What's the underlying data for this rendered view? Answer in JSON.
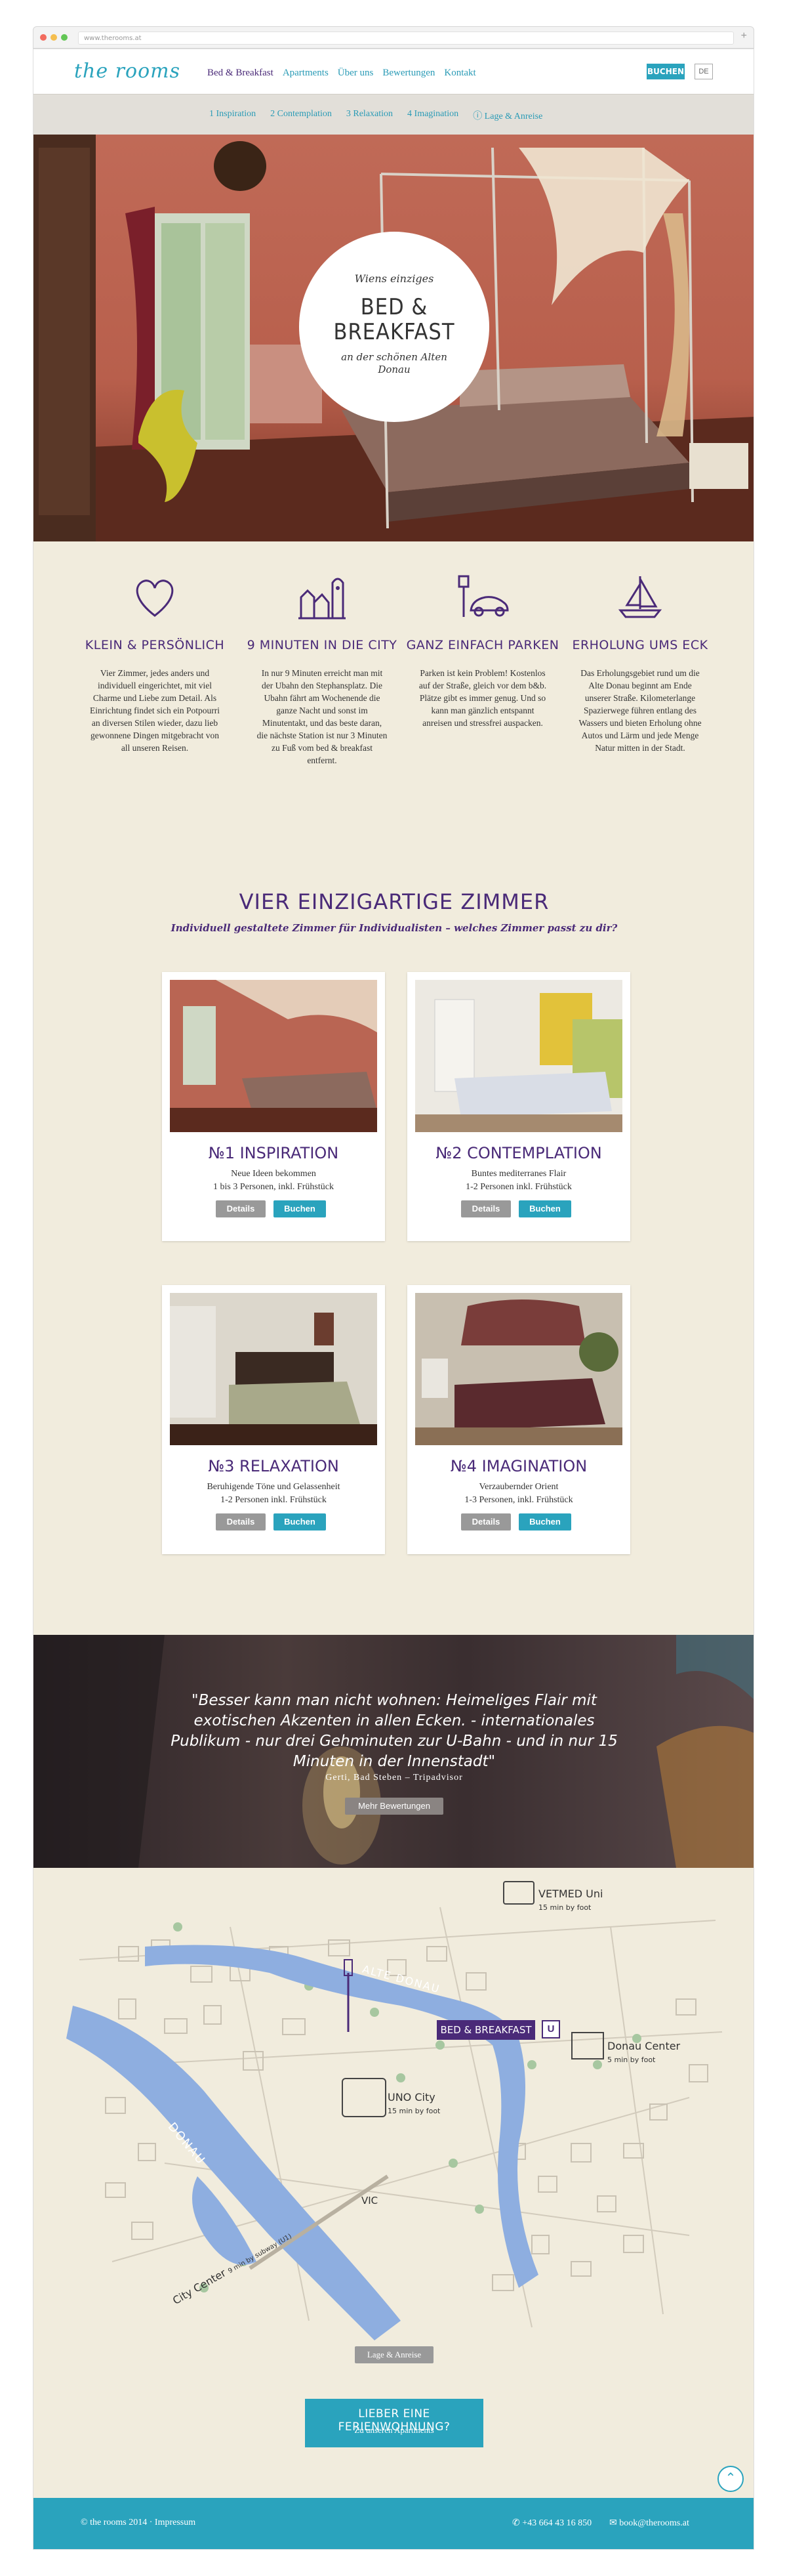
{
  "browser": {
    "url": "www.therooms.at"
  },
  "header": {
    "logo": "the rooms",
    "nav": [
      "Bed & Breakfast",
      "Apartments",
      "Über uns",
      "Bewertungen",
      "Kontakt"
    ],
    "book_label": "BUCHEN",
    "lang_label": "DE"
  },
  "subnav": [
    "1 Inspiration",
    "2 Contemplation",
    "3 Relaxation",
    "4 Imagination",
    "ⓘ Lage & Anreise"
  ],
  "hero": {
    "line1": "Wiens einziges",
    "line2": "BED &",
    "line2b": "BREAKFAST",
    "line3": "an der schönen Alten Donau"
  },
  "features": [
    {
      "icon": "heart-icon",
      "title": "KLEIN & PERSÖNLICH",
      "text": "Vier Zimmer, jedes anders und individuell eingerichtet, mit viel Charme und Liebe zum Detail. Als Einrichtung findet sich ein Potpourri an diversen Stilen wieder, dazu lieb gewonnene Dingen mitgebracht von all unseren Reisen."
    },
    {
      "icon": "city-icon",
      "title": "9 MINUTEN IN DIE CITY",
      "text": "In nur 9 Minuten erreicht man mit der Ubahn den Stephansplatz. Die Ubahn fährt am Wochenende die ganze Nacht und sonst im Minutentakt, und das beste daran, die nächste Station ist nur 3 Minuten zu Fuß vom bed & breakfast entfernt."
    },
    {
      "icon": "car-parking-icon",
      "title": "GANZ EINFACH PARKEN",
      "text": "Parken ist kein Problem! Kostenlos auf der Straße, gleich vor dem b&b. Plätze gibt es immer genug. Und so kann man gänzlich entspannt anreisen und stressfrei auspacken."
    },
    {
      "icon": "sailboat-icon",
      "title": "ERHOLUNG UMS ECK",
      "text": "Das Erholungsgebiet rund um die Alte Donau beginnt am Ende unserer Straße. Kilometerlange Spazierwege führen entlang des Wassers und bieten Erholung ohne Autos und Lärm und jede Menge Natur mitten in der Stadt."
    }
  ],
  "rooms_section": {
    "title": "VIER EINZIGARTIGE ZIMMER",
    "subtitle": "Individuell gestaltete Zimmer für Individualisten – welches Zimmer passt zu dir?",
    "details_label": "Details",
    "book_label": "Buchen",
    "rooms": [
      {
        "name": "№1 INSPIRATION",
        "desc1": "Neue Ideen bekommen",
        "desc2": "1 bis 3 Personen, inkl. Frühstück",
        "accent": "#c06a57"
      },
      {
        "name": "№2 CONTEMPLATION",
        "desc1": "Buntes mediterranes Flair",
        "desc2": "1-2 Personen inkl. Frühstück",
        "accent": "#e2c23a"
      },
      {
        "name": "№3 RELAXATION",
        "desc1": "Beruhigende Töne und Gelassenheit",
        "desc2": "1-2 Personen inkl. Frühstück",
        "accent": "#6b5a48"
      },
      {
        "name": "№4 IMAGINATION",
        "desc1": "Verzaubernder Orient",
        "desc2": "1-3 Personen, inkl. Frühstück",
        "accent": "#7a3d3a"
      }
    ]
  },
  "quote": {
    "text": "\"Besser kann man nicht wohnen: Heimeliges Flair mit exotischen Akzenten in allen Ecken. - internationales Publikum - nur drei Gehminuten zur U-Bahn - und in nur 15 Minuten in der Innenstadt\"",
    "author": "Gerti, Bad Steben – Tripadvisor",
    "button": "Mehr Bewertungen"
  },
  "map": {
    "river_label": "DONAU",
    "old_river_label": "ALTE DONAU",
    "bnb_label": "BED & BREAKFAST",
    "ubahn_label": "U",
    "places": [
      {
        "name": "VETMED Uni",
        "note": "15 min by foot"
      },
      {
        "name": "Donau Center",
        "note": "5 min by foot"
      },
      {
        "name": "UNO City",
        "note": "15 min by foot"
      },
      {
        "name": "VIC",
        "note": ""
      },
      {
        "name": "City Center",
        "note": "9 min by subway (U1)"
      }
    ],
    "button": "Lage & Anreise"
  },
  "apartments_cta": {
    "line1": "LIEBER EINE FERIENWOHNUNG?",
    "line2": "Zu unseren Apartments"
  },
  "footer": {
    "left": "© the rooms 2014 · Impressum",
    "phone": "+43 664 43 16 850",
    "mail": "book@therooms.at"
  },
  "colors": {
    "accent": "#2aa3bd",
    "purple": "#4a2a78",
    "background": "#f1ecdd"
  }
}
